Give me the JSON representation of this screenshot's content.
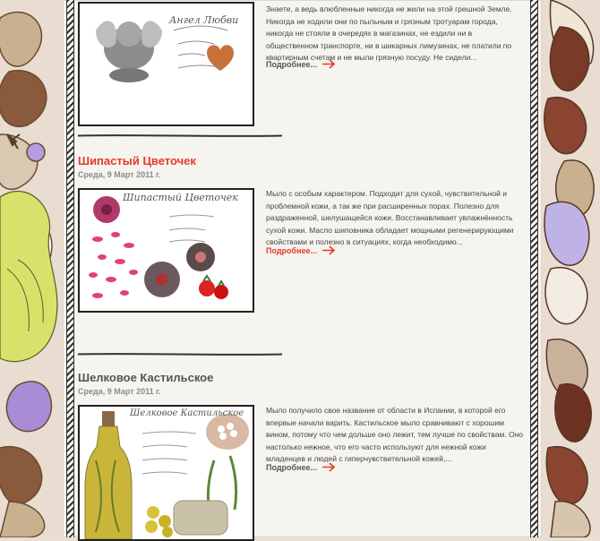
{
  "colors": {
    "accent": "#e23b2d",
    "text": "#444444",
    "meta": "#8a8a8a",
    "page_bg": "#f6f4ef"
  },
  "posts": [
    {
      "excerpt": "Знаете, а ведь влюбленные никогда не жили на этой грешной Земле. Никогда не ходили они по пыльным и грязным тротуарам города, никогда не стояли в очередях в магазинах, не ездили ни в общественном транспорте, ни в шикарных лимузинах, не платили по квартирным счетам и не мыли грязную посуду. Не сидели...",
      "more_label": "Подробнее...",
      "image_caption": "Ангел Любви",
      "image_icons": [
        "cherub-icon",
        "heart-icon"
      ]
    },
    {
      "title": "Шипастый Цветочек",
      "date": "Среда, 9 Март 2011 г.",
      "excerpt": "Мыло с особым характером. Подходит для сухой, чувствительной и проблемной кожи, а так же при расширенных порах. Полезно для раздраженной, шелушащейся кожи. Восстанавливает увлажнённость сухой кожи. Масло шиповника обладает мощными регенерирующими свойствами и полезно в ситуациях, когда необходимо...",
      "more_label": "Подробнее...",
      "image_caption": "Шипастый Цветочек"
    },
    {
      "title": "Шелковое Кастильское",
      "date": "Среда, 9 Март 2011 г.",
      "excerpt": "Мыло получило свое название от области в Испании, в которой его впервые начали варить. Кастильское мыло сравнивают с хорошим вином, потому что чем дольше оно лежит, тем лучше по свойствам. Оно настолько нежное, что его часто используют для нежной кожи младенцев и людей с гиперчувствительной кожей,...",
      "more_label": "Подробнее...",
      "image_caption": "Шелковое Кастильское"
    }
  ]
}
